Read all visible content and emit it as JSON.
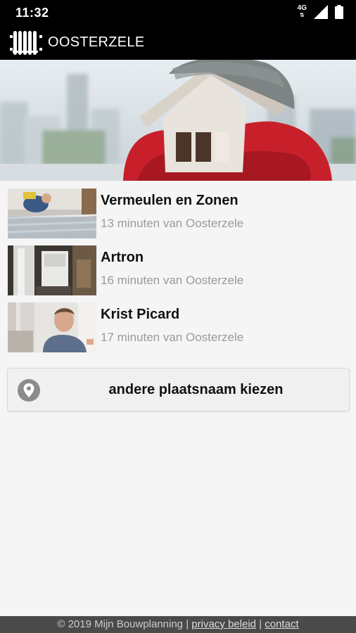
{
  "status_bar": {
    "time": "11:32",
    "network": "4G"
  },
  "app_bar": {
    "title": "OOSTERZELE"
  },
  "companies": [
    {
      "name": "Vermeulen en Zonen",
      "distance": "13 minuten van Oosterzele"
    },
    {
      "name": "Artron",
      "distance": "16 minuten van Oosterzele"
    },
    {
      "name": "Krist Picard",
      "distance": "17 minuten van Oosterzele"
    }
  ],
  "choose_button": {
    "label": "andere plaatsnaam kiezen"
  },
  "footer": {
    "copyright": "© 2019 Mijn Bouwplanning",
    "separator": "|",
    "privacy": "privacy beleid",
    "contact": "contact"
  }
}
